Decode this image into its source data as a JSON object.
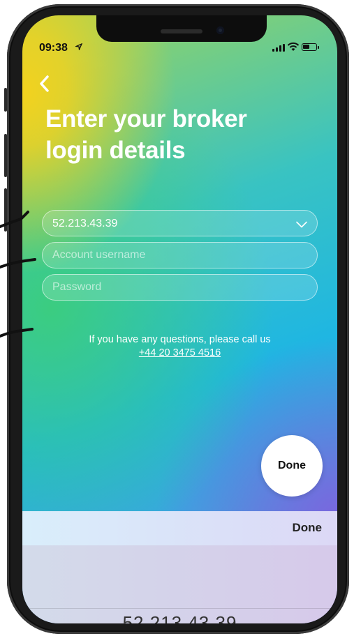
{
  "status_bar": {
    "time": "09:38",
    "location_icon": "location-arrow-icon",
    "signal_icon": "cellular-signal-icon",
    "wifi_icon": "wifi-icon",
    "battery_icon": "battery-icon"
  },
  "header": {
    "back_icon": "chevron-left-icon",
    "title_line1": "Enter your broker",
    "title_line2": "login details"
  },
  "form": {
    "server_value": "52.213.43.39",
    "username_placeholder": "Account username",
    "password_placeholder": "Password"
  },
  "help": {
    "text": "If you have any questions, please call us",
    "phone": "+44 20 3475 4516"
  },
  "actions": {
    "done_circle_label": "Done",
    "toolbar_done_label": "Done"
  },
  "picker": {
    "selected_value": "52.213.43.39"
  },
  "colors": {
    "gradient_yellow": "#f3d21e",
    "gradient_green": "#3cce78",
    "gradient_cyan": "#1fb6e2",
    "gradient_purple": "#7c64de"
  }
}
